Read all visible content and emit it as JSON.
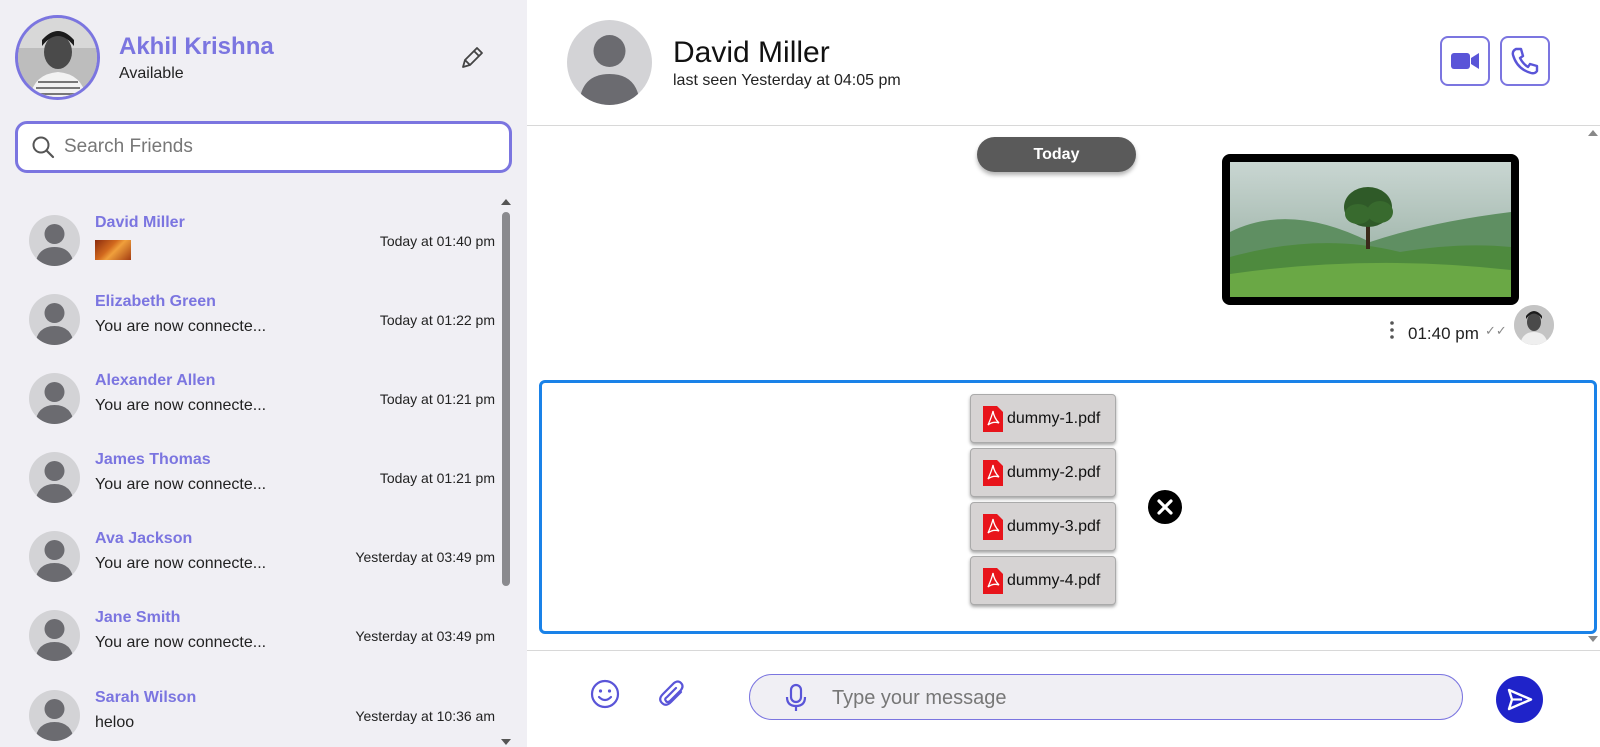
{
  "user": {
    "name": "Akhil Krishna",
    "status": "Available"
  },
  "search": {
    "placeholder": "Search Friends"
  },
  "friends": [
    {
      "name": "David Miller",
      "message": "",
      "has_image": true,
      "time": "Today at 01:40 pm"
    },
    {
      "name": "Elizabeth Green",
      "message": "You are now connecte...",
      "time": "Today at 01:22 pm"
    },
    {
      "name": "Alexander Allen",
      "message": "You are now connecte...",
      "time": "Today at 01:21 pm"
    },
    {
      "name": "James Thomas",
      "message": "You are now connecte...",
      "time": "Today at 01:21 pm"
    },
    {
      "name": "Ava Jackson",
      "message": "You are now connecte...",
      "time": "Yesterday at 03:49 pm"
    },
    {
      "name": "Jane Smith",
      "message": "You are now connecte...",
      "time": "Yesterday at 03:49 pm"
    },
    {
      "name": "Sarah Wilson",
      "message": "heloo",
      "time": "Yesterday at 10:36 am"
    }
  ],
  "chat": {
    "contact_name": "David Miller",
    "last_seen": "last seen Yesterday at 04:05 pm",
    "day_label": "Today",
    "message_time": "01:40 pm",
    "message_ticks": "✓✓"
  },
  "attachments": [
    "dummy-1.pdf",
    "dummy-2.pdf",
    "dummy-3.pdf",
    "dummy-4.pdf"
  ],
  "composer": {
    "placeholder": "Type your message"
  },
  "colors": {
    "accent": "#7b75e0",
    "send": "#1f23c9",
    "attach_border": "#1a82e8",
    "sidebar_bg": "#f0eff4",
    "pdf_red": "#e8141b"
  },
  "icons": [
    "search-icon",
    "pencil-icon",
    "video-camera-icon",
    "phone-icon",
    "kebab-icon",
    "double-check-icon",
    "pdf-icon",
    "close-icon",
    "smiley-icon",
    "paperclip-icon",
    "microphone-icon",
    "send-icon"
  ]
}
